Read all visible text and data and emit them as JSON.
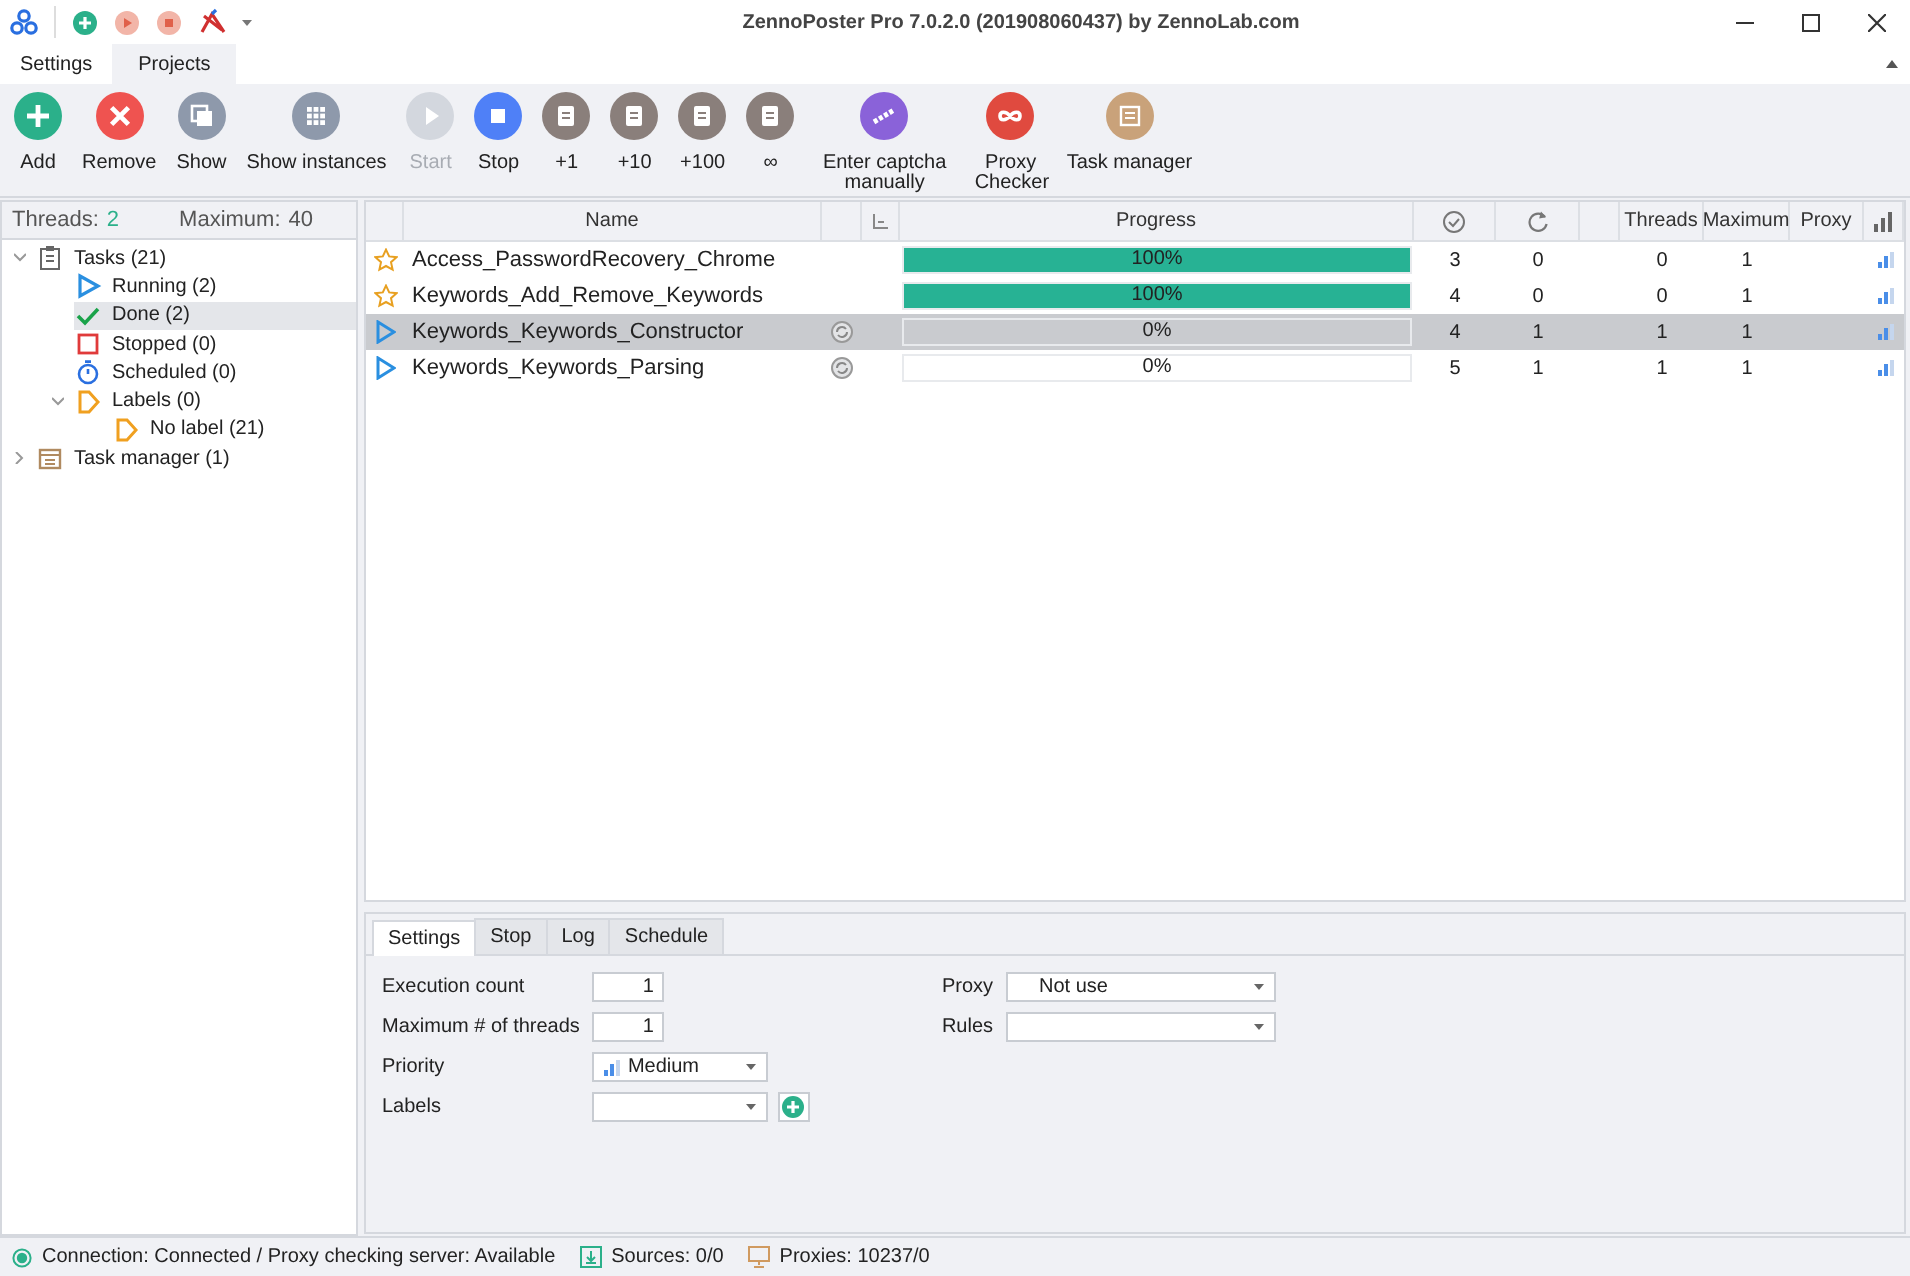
{
  "window": {
    "title": "ZennoPoster Pro 7.0.2.0 (201908060437) by ZennoLab.com"
  },
  "ribbon_tabs": [
    {
      "label": "Settings",
      "selected": false
    },
    {
      "label": "Projects",
      "selected": true
    }
  ],
  "toolbar": [
    {
      "label": "Add",
      "kind": "plus",
      "color": "#2bb08a",
      "disabled": false
    },
    {
      "label": "Remove",
      "kind": "cross",
      "color": "#ef5350",
      "disabled": false
    },
    {
      "label": "Show",
      "kind": "copy",
      "color": "#8e99ab",
      "disabled": false
    },
    {
      "label": "Show instances",
      "kind": "grid",
      "color": "#8e99ab",
      "disabled": false
    },
    {
      "label": "Start",
      "kind": "play",
      "color": "#d3d7de",
      "disabled": true
    },
    {
      "label": "Stop",
      "kind": "stop",
      "color": "#4f80f7",
      "disabled": false
    },
    {
      "label": "+1",
      "kind": "clipboard",
      "color": "#8a7f7b",
      "disabled": false
    },
    {
      "label": "+10",
      "kind": "clipboard",
      "color": "#8a7f7b",
      "disabled": false
    },
    {
      "label": "+100",
      "kind": "clipboard",
      "color": "#8a7f7b",
      "disabled": false
    },
    {
      "label": "∞",
      "kind": "clipboard",
      "color": "#8a7f7b",
      "disabled": false
    },
    {
      "label": "Enter captcha manually",
      "kind": "captcha",
      "color": "#8a62d9",
      "disabled": false
    },
    {
      "label": "Proxy Checker",
      "kind": "infinity",
      "color": "#e04a3f",
      "disabled": false
    },
    {
      "label": "Task manager",
      "kind": "list",
      "color": "#c9a27a",
      "disabled": false
    }
  ],
  "threads_panel": {
    "threads_label": "Threads:",
    "threads": "2",
    "maximum_label": "Maximum:",
    "maximum": "40"
  },
  "tree": [
    {
      "label": "Tasks (21)",
      "kind": "clipboard",
      "expanded": true,
      "selected": false,
      "children": [
        {
          "label": "Running (2)",
          "kind": "play",
          "selected": false
        },
        {
          "label": "Done (2)",
          "kind": "check",
          "selected": true
        },
        {
          "label": "Stopped (0)",
          "kind": "stop",
          "selected": false
        },
        {
          "label": "Scheduled (0)",
          "kind": "timer",
          "selected": false
        },
        {
          "label": "Labels (0)",
          "kind": "label",
          "expanded": true,
          "selected": false,
          "children": [
            {
              "label": "No label (21)",
              "kind": "label",
              "selected": false
            }
          ]
        }
      ]
    },
    {
      "label": "Task manager (1)",
      "kind": "calendar",
      "expanded": false,
      "selected": false
    }
  ],
  "table": {
    "columns": [
      {
        "kind": "blank"
      },
      {
        "kind": "text",
        "label": "Name"
      },
      {
        "kind": "blank"
      },
      {
        "kind": "sort"
      },
      {
        "kind": "text",
        "label": "Progress"
      },
      {
        "kind": "done"
      },
      {
        "kind": "retry"
      },
      {
        "kind": "blank"
      },
      {
        "kind": "text",
        "label": "Threads"
      },
      {
        "kind": "text",
        "label": "Maximum"
      },
      {
        "kind": "text",
        "label": "Proxy"
      },
      {
        "kind": "priority"
      }
    ],
    "rows": [
      {
        "kind": "favorite",
        "name": "Access_PasswordRecovery_Chrome",
        "reused": false,
        "progress": {
          "level": 1,
          "text": "100%"
        },
        "done": "3",
        "retries": "0",
        "threads": "0",
        "maximum": "1",
        "selected": false
      },
      {
        "kind": "favorite",
        "name": "Keywords_Add_Remove_Keywords",
        "reused": false,
        "progress": {
          "level": 1,
          "text": "100%"
        },
        "done": "4",
        "retries": "0",
        "threads": "0",
        "maximum": "1",
        "selected": false
      },
      {
        "kind": "running",
        "name": "Keywords_Keywords_Constructor",
        "reused": true,
        "progress": {
          "level": 0,
          "text": "0%"
        },
        "done": "4",
        "retries": "1",
        "threads": "1",
        "maximum": "1",
        "selected": true
      },
      {
        "kind": "running",
        "name": "Keywords_Keywords_Parsing",
        "reused": true,
        "progress": {
          "level": 0,
          "text": "0%"
        },
        "done": "5",
        "retries": "1",
        "threads": "1",
        "maximum": "1",
        "selected": false
      }
    ]
  },
  "details": {
    "tabs": [
      {
        "label": "Settings",
        "selected": true
      },
      {
        "label": "Stop",
        "selected": false
      },
      {
        "label": "Log",
        "selected": false
      },
      {
        "label": "Schedule",
        "selected": false
      }
    ],
    "execution_count": {
      "label": "Execution count",
      "value": "1"
    },
    "max_threads": {
      "label": "Maximum # of threads",
      "value": "1"
    },
    "priority": {
      "label": "Priority",
      "value": "Medium"
    },
    "labels": {
      "label": "Labels"
    },
    "proxy": {
      "label": "Proxy",
      "value": "Not use"
    },
    "rules": {
      "label": "Rules"
    }
  },
  "status_bar": {
    "connection": "Connection: Connected / Proxy checking server: Available",
    "sources": "Sources: 0/0",
    "proxies": "Proxies: 10237/0"
  }
}
